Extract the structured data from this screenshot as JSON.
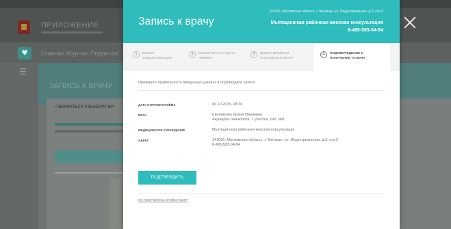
{
  "background": {
    "brand": "ПРИЛОЖЕНИЕ",
    "nav_text": "Главная   Журнал Подписок",
    "banner_text": "ЗАПИСЬ К ВРАЧУ",
    "back_link": "< ВЕРНУТЬСЯ К ВЫБОРУ ВР"
  },
  "modal": {
    "title": "Запись к врачу",
    "header_address": "141006, Московская область, г. Мытищи, ул. Индустриальная, д.3, стр.2",
    "header_org": "Мытищинская районная женская консультация",
    "header_phone": "8-495-583-04-94",
    "steps": [
      {
        "num": "1",
        "label": "Выбор специализации",
        "active": false
      },
      {
        "num": "2",
        "label": "Выбор врача и даты приема",
        "active": false
      },
      {
        "num": "3",
        "label": "Выбор времени посещения врача",
        "active": false
      },
      {
        "num": "4",
        "label": "Подтверждение и получение талона",
        "active": true
      }
    ],
    "intro": "Проверьте правильность введенных данных и подтвердите запись",
    "details": [
      {
        "label": "Дата и время приёма",
        "value": "06.10.2015, 08:30"
      },
      {
        "label": "Врач",
        "value": "Щенникова Ирина Ивановна\nАкушерка гинеколога, 1 участок, каб. №8"
      },
      {
        "label": "Медицинское учреждение",
        "value": "Мытищинская районная женская консультация"
      },
      {
        "label": "Адрес",
        "value": "141006, Московская область, г. Мытищи, ул. Индустриальная, д.3, стр.2\n8-495-583-04-94"
      }
    ],
    "confirm_label": "Подтвердить",
    "help_link": "Не получилось записаться?"
  },
  "colors": {
    "accent": "#2fbcbc",
    "overlay": "#6f7472"
  },
  "icons": {
    "close": "close-icon",
    "logo": "coat-of-arms-icon",
    "heart": "heart-icon",
    "menu": "hamburger-icon"
  }
}
